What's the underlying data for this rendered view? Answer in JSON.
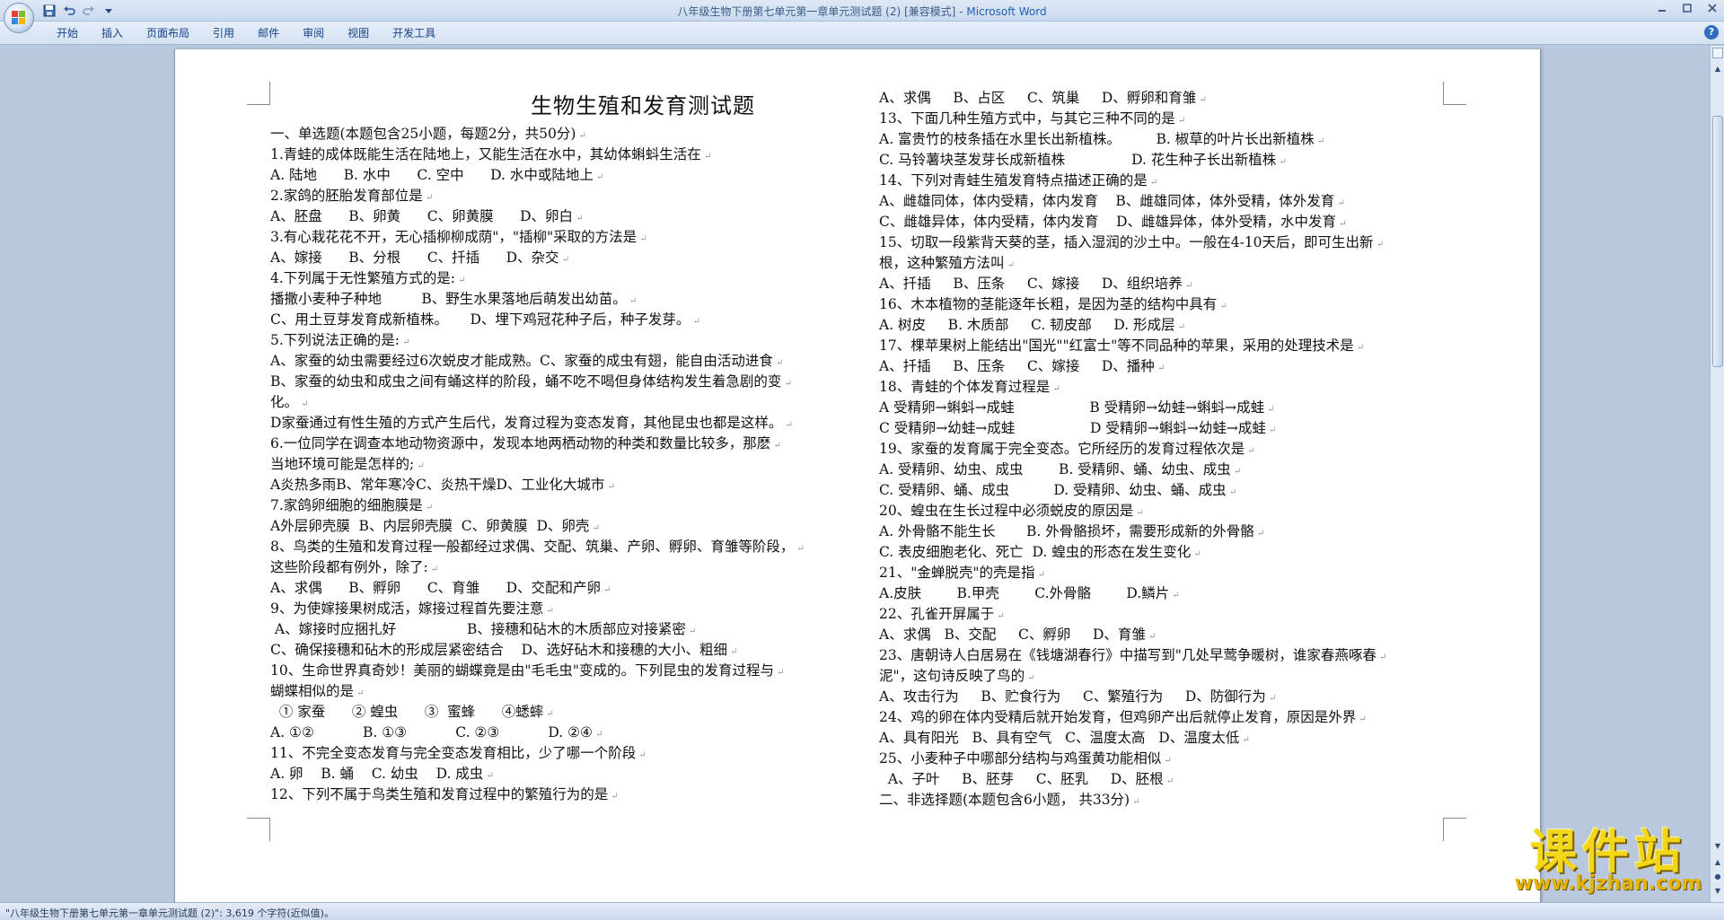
{
  "window": {
    "title": "八年级生物下册第七单元第一章单元测试题 (2) [兼容模式]",
    "app_name": "Microsoft Word"
  },
  "qat": {
    "save_icon": "save-icon",
    "undo_icon": "undo-icon",
    "redo_icon": "redo-icon"
  },
  "ribbon": {
    "tabs": [
      {
        "label": "开始"
      },
      {
        "label": "插入"
      },
      {
        "label": "页面布局"
      },
      {
        "label": "引用"
      },
      {
        "label": "邮件"
      },
      {
        "label": "审阅"
      },
      {
        "label": "视图"
      },
      {
        "label": "开发工具"
      }
    ],
    "help_glyph": "?"
  },
  "document": {
    "heading": "生物生殖和发育测试题",
    "left_lines": [
      "一、单选题(本题包含25小题，每题2分，共50分)",
      "1.青蛙的成体既能生活在陆地上，又能生活在水中，其幼体蝌蚪生活在",
      "A. 陆地      B. 水中      C. 空中      D. 水中或陆地上",
      "2.家鸽的胚胎发育部位是",
      "A、胚盘      B、卵黄      C、卵黄膜      D、卵白",
      "3.有心栽花花不开，无心插柳柳成荫\"，\"插柳\"采取的方法是",
      "A、嫁接      B、分根      C、扦插      D、杂交",
      "4.下列属于无性繁殖方式的是:",
      "播撒小麦种子种地         B、野生水果落地后萌发出幼苗。",
      "C、用土豆芽发育成新植株。     D、埋下鸡冠花种子后，种子发芽。",
      "5.下列说法正确的是:",
      "A、家蚕的幼虫需要经过6次蜕皮才能成熟。C、家蚕的成虫有翅，能自由活动进食",
      "B、家蚕的幼虫和成虫之间有蛹这样的阶段，蛹不吃不喝但身体结构发生着急剧的变",
      "化。",
      "D家蚕通过有性生殖的方式产生后代，发育过程为变态发育，其他昆虫也都是这样。",
      "6.一位同学在调查本地动物资源中，发现本地两栖动物的种类和数量比较多，那麽",
      "当地环境可能是怎样的;",
      "A炎热多雨B、常年寒冷C、炎热干燥D、工业化大城市",
      "7.家鸽卵细胞的细胞膜是",
      "A外层卵壳膜  B、内层卵壳膜  C、卵黄膜  D、卵壳",
      "8、鸟类的生殖和发育过程一般都经过求偶、交配、筑巢、产卵、孵卵、育雏等阶段，",
      "这些阶段都有例外，除了:",
      "A、求偶      B、孵卵      C、育雏      D、交配和产卵",
      "9、为使嫁接果树成活，嫁接过程首先要注意",
      " A、嫁接时应捆扎好                B、接穗和砧木的木质部应对接紧密",
      "C、确保接穗和砧木的形成层紧密结合    D、选好砧木和接穗的大小、粗细",
      "10、生命世界真奇妙！美丽的蝴蝶竟是由\"毛毛虫\"变成的。下列昆虫的发育过程与",
      "蝴蝶相似的是",
      "  ① 家蚕      ② 蝗虫      ③  蜜蜂      ④蟋蟀",
      "A. ①②           B. ①③           C. ②③           D. ②④",
      "11、不完全变态发育与完全变态发育相比，少了哪一个阶段",
      "A. 卵    B. 蛹    C. 幼虫    D. 成虫",
      "12、下列不属于鸟类生殖和发育过程中的繁殖行为的是"
    ],
    "right_lines": [
      "A、求偶     B、占区     C、筑巢     D、孵卵和育雏",
      "13、下面几种生殖方式中，与其它三种不同的是",
      "A. 富贵竹的枝条插在水里长出新植株。        B. 椒草的叶片长出新植株",
      "C. 马铃薯块茎发芽长成新植株               D. 花生种子长出新植株",
      "14、下列对青蛙生殖发育特点描述正确的是",
      "A、雌雄同体，体内受精，体内发育    B、雌雄同体，体外受精，体外发育",
      "C、雌雄异体，体内受精，体内发育    D、雌雄异体，体外受精，水中发育",
      "15、切取一段紫背天葵的茎，插入湿润的沙土中。一般在4-10天后，即可生出新",
      "根，这种繁殖方法叫",
      "A、扦插     B、压条     C、嫁接     D、组织培养",
      "16、木本植物的茎能逐年长粗，是因为茎的结构中具有",
      "A. 树皮     B. 木质部     C. 韧皮部     D. 形成层",
      "17、棵苹果树上能结出\"国光\"\"红富士\"等不同品种的苹果，采用的处理技术是",
      "A、扦插     B、压条     C、嫁接     D、播种",
      "18、青蛙的个体发育过程是",
      "A 受精卵→蝌蚪→成蛙                 B 受精卵→幼蛙→蝌蚪→成蛙",
      "C 受精卵→幼蛙→成蛙                 D 受精卵→蝌蚪→幼蛙→成蛙",
      "19、家蚕的发育属于完全变态。它所经历的发育过程依次是",
      "A. 受精卵、幼虫、成虫        B. 受精卵、蛹、幼虫、成虫",
      "C. 受精卵、蛹、成虫          D. 受精卵、幼虫、蛹、成虫",
      "20、蝗虫在生长过程中必须蜕皮的原因是",
      "A. 外骨骼不能生长       B. 外骨骼损坏，需要形成新的外骨骼",
      "C. 表皮细胞老化、死亡  D. 蝗虫的形态在发生变化",
      "21、\"金蝉脱壳\"的壳是指",
      "A.皮肤        B.甲壳        C.外骨骼        D.鳞片",
      "22、孔雀开屏属于",
      "A、求偶   B、交配     C、孵卵     D、育雏",
      "23、唐朝诗人白居易在《钱塘湖春行》中描写到\"几处早莺争暖树，谁家春燕啄春",
      "泥\"，这句诗反映了鸟的",
      "A、攻击行为     B、贮食行为     C、繁殖行为     D、防御行为",
      "24、鸡的卵在体内受精后就开始发育，但鸡卵产出后就停止发育，原因是外界",
      "A、具有阳光   B、具有空气   C、温度太高   D、温度太低",
      "25、小麦种子中哪部分结构与鸡蛋黄功能相似",
      "  A、子叶     B、胚芽     C、胚乳     D、胚根",
      "二、非选择题(本题包含6小题， 共33分)"
    ]
  },
  "statusbar": {
    "text": "\"八年级生物下册第七单元第一章单元测试题 (2)\": 3,619 个字符(近似值)。"
  },
  "watermark": {
    "main": "课件站",
    "url": "www.kjzhan.com"
  },
  "colors": {
    "ribbon_text": "#15428b",
    "workspace_bg": "#b9c8dc",
    "watermark": "#f2d61a"
  }
}
